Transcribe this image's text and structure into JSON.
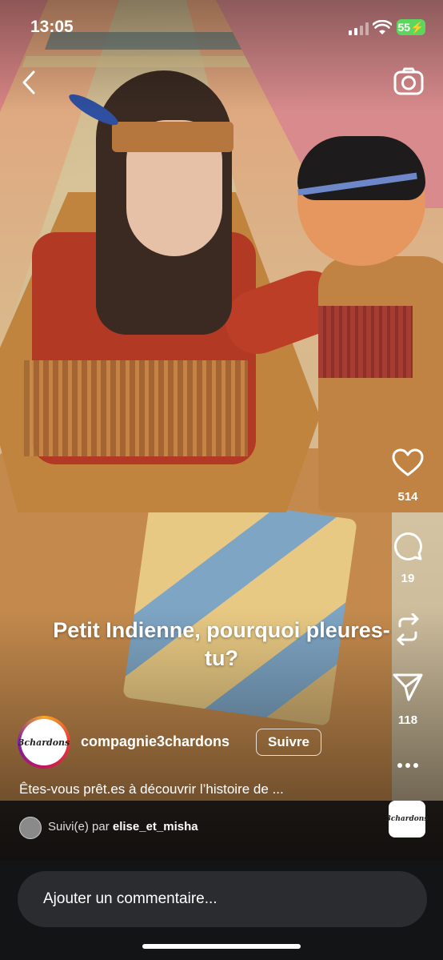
{
  "status_bar": {
    "time": "13:05",
    "battery": "55"
  },
  "overlay": {
    "title": "Petit Indienne, pourquoi pleures-tu?"
  },
  "rail": {
    "likes": "514",
    "comments": "19",
    "shares": "118"
  },
  "author": {
    "avatar_text": "3chardons",
    "username": "compagnie3chardons",
    "follow_label": "Suivre",
    "description": "Êtes-vous prêt.es à découvrir l’histoire de ...",
    "followed_prefix": "Suivi(e) par",
    "followed_user": "elise_et_misha"
  },
  "audio": {
    "thumb_text": "3chardons"
  },
  "comment": {
    "placeholder": "Ajouter un commentaire..."
  },
  "colors": {
    "battery": "#5cd65c",
    "bottom_bar": "#131415",
    "comment_box": "#2a2c2f"
  },
  "icons": [
    "back-icon",
    "camera-icon",
    "heart-icon",
    "comment-icon",
    "repost-icon",
    "send-icon",
    "more-icon"
  ]
}
